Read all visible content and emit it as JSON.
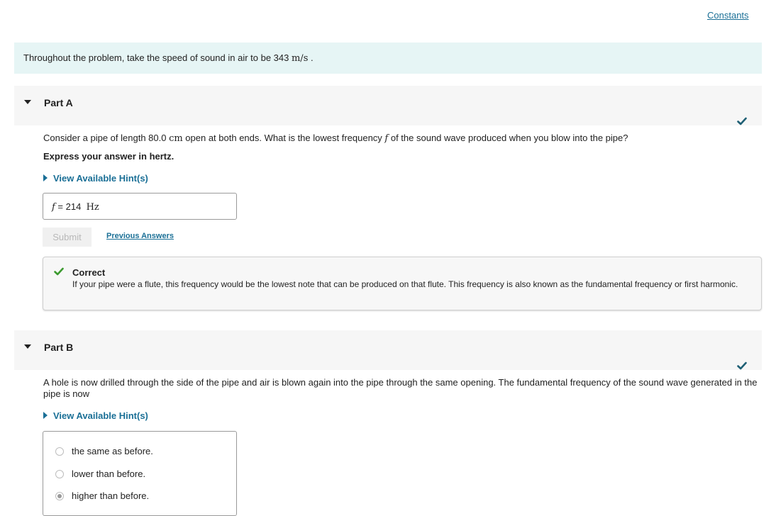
{
  "constants_link": "Constants",
  "intro": {
    "text": "Throughout the problem, take the speed of sound in air to be 343 ",
    "unit": "m/s",
    "suffix": " ."
  },
  "part_a": {
    "title": "Part A",
    "question_pre": "Consider a pipe of length 80.0 ",
    "question_unit": "cm",
    "question_mid": " open at both ends. What is the lowest frequency ",
    "question_var": "f",
    "question_post": " of the sound wave produced when you blow into the pipe?",
    "instruction": "Express your answer in hertz.",
    "hint_label": "View Available Hint(s)",
    "answer_var": "f",
    "answer_eq": " = ",
    "answer_value": "214",
    "answer_unit": "Hz",
    "submit_label": "Submit",
    "previous_answers_label": "Previous Answers",
    "feedback_title": "Correct",
    "feedback_body": "If your pipe were a flute, this frequency would be the lowest note that can be produced on that flute. This frequency is also known as the fundamental frequency or first harmonic."
  },
  "part_b": {
    "title": "Part B",
    "question": "A hole is now drilled through the side of the pipe and air is blown again into the pipe through the same opening. The fundamental frequency of the sound wave generated in the pipe is now",
    "hint_label": "View Available Hint(s)",
    "choices": [
      {
        "label": "the same as before.",
        "selected": false
      },
      {
        "label": "lower than before.",
        "selected": false
      },
      {
        "label": "higher than before.",
        "selected": true
      }
    ]
  },
  "colors": {
    "accent": "#1a6f96",
    "check": "#1e5f74",
    "correct_green": "#3c9a2f",
    "intro_bg": "#e6f5f5"
  },
  "icons": {
    "check": "check-icon",
    "collapse": "triangle-down-icon",
    "expand": "triangle-right-icon"
  }
}
